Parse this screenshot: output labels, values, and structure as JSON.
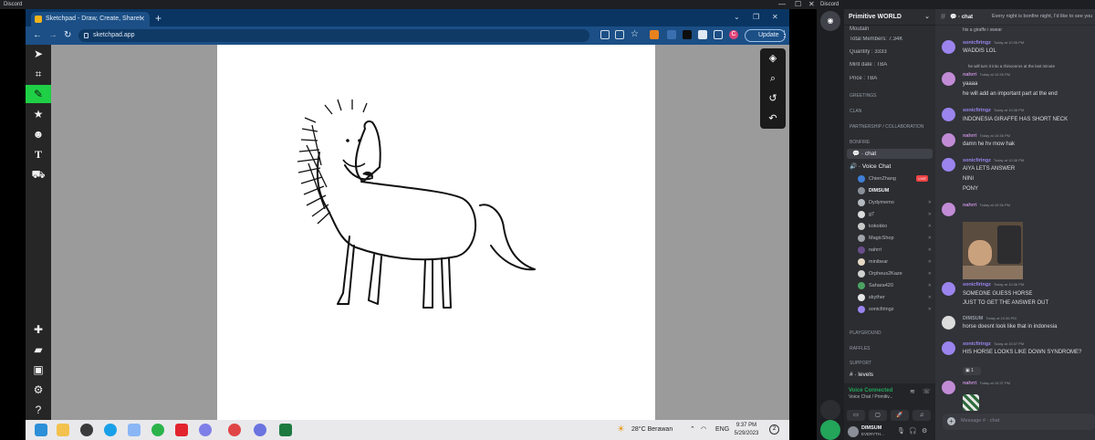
{
  "titlebar": {
    "left_app": "Discord",
    "right_app": "Discord"
  },
  "browser": {
    "tab_title": "Sketchpad - Draw, Create, Share!",
    "url": "sketchpad.app",
    "update_label": "Update",
    "profile_initial": "C"
  },
  "sketchpad": {
    "left_tools": [
      "pointer-icon",
      "crop-icon",
      "brush-icon",
      "star-icon",
      "emoji-icon",
      "text-icon",
      "fill-icon"
    ],
    "bottom_tools": [
      "add-icon",
      "folder-icon",
      "save-icon",
      "settings-icon",
      "help-icon"
    ],
    "right_tools": [
      "layers-icon",
      "zoom-icon",
      "history-icon",
      "undo-icon"
    ],
    "accent": "#1fcf45"
  },
  "taskbar": {
    "weather": "28°C  Berawan",
    "lang": "ENG",
    "time": "9:37 PM",
    "date": "5/29/2023",
    "notifications": "2"
  },
  "discord": {
    "server_name": "Primitive WORLD",
    "info_channels": [
      "Moutain",
      "Total Members: 7.34K",
      "Quantity : 3333",
      "Mint date : TBA",
      "Price : TBA"
    ],
    "categories": {
      "greetings": "GREETINGS",
      "clan": "CLAN",
      "partnership": "PARTNERSHIP / COLLABORATION",
      "bonfire": "BONFIRE",
      "playground": "PLAYGROUND",
      "raffles": "RAFFLES",
      "support": "SUPPORT"
    },
    "selected_channel": "chat",
    "voice_channel": "Voice Chat",
    "live_badge": "LIVE",
    "voice_users": [
      "ChienZhang",
      "DIMSUM",
      "Dydymemo",
      "g7",
      "kokokko",
      "MagicShop",
      "nahrri",
      "minibear",
      "Orpheus2Kaze",
      "Sahara420",
      "skyther",
      "sonicfiringz"
    ],
    "levels_channel": "levels",
    "voice_status": "Voice Connected",
    "voice_sub": "Voice Chat / Primitiv...",
    "user_name": "DIMSUM",
    "user_sub": "EVERYTH...",
    "chat_header": "chat",
    "chat_topic": "Every night is bonfire night, I'd like to see you",
    "top_partial": "his a giraffe i swear",
    "messages": [
      {
        "author": "sonicfiringz",
        "time": "Today at 10:35 PM",
        "lines": [
          "WADDIS LOL"
        ]
      },
      {
        "reply": "he will turn it into a rhinoceros at the last minute",
        "author": "nahrri",
        "time": "Today at 10:35 PM",
        "lines": [
          "yaaaa",
          "he will add an important part at the end"
        ]
      },
      {
        "author": "sonicfiringz",
        "time": "Today at 10:36 PM",
        "lines": [
          "INDONESIA GIRAFFE HAS SHORT NECK"
        ]
      },
      {
        "author": "nahrri",
        "time": "Today at 10:36 PM",
        "lines": [
          "damn he hv mow hak"
        ]
      },
      {
        "author": "sonicfiringz",
        "time": "Today at 10:36 PM",
        "lines": [
          "AIYA LETS ANSWER",
          "NINI",
          "PONY"
        ]
      },
      {
        "author": "nahrri",
        "time": "Today at 10:36 PM",
        "lines": []
      },
      {
        "author": "sonicfiringz",
        "time": "Today at 10:36 PM",
        "lines": [
          "SOMEONE GUESS HORSE",
          "JUST TO GET THE ANSWER OUT"
        ]
      },
      {
        "author": "DIMSUM",
        "time": "Today at 10:36 PM",
        "lines": [
          "horse doesnt look like that in indonesia"
        ]
      },
      {
        "author": "sonicfiringz",
        "time": "Today at 10:37 PM",
        "lines": [
          "HIS HORSE LOOKS LIKE DOWN SYNDROME?"
        ]
      },
      {
        "author": "nahrri",
        "time": "Today at 10:37 PM",
        "lines": []
      }
    ],
    "reaction_count": "1",
    "input_placeholder": "Message #  · chat",
    "colors": {
      "sonic": "#9b84ee",
      "nahrri": "#c28bd6",
      "dimsum": "#949ba4"
    }
  }
}
